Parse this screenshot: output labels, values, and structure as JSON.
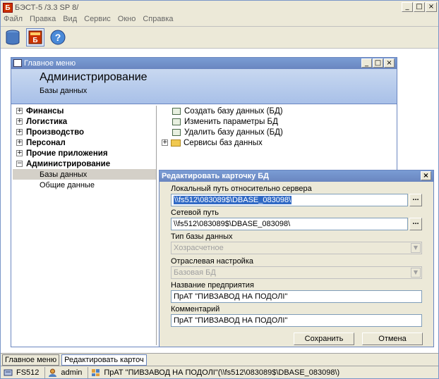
{
  "app": {
    "title": "БЭСТ-5 /3.3 SP 8/",
    "logo_text": "Б",
    "window_controls": {
      "minimize": "_",
      "maximize": "□",
      "close": "×"
    }
  },
  "menubar": [
    "Файл",
    "Правка",
    "Вид",
    "Сервис",
    "Окно",
    "Справка"
  ],
  "toolbar": {
    "icons": [
      "database-icon",
      "app-logo-icon",
      "help-icon"
    ],
    "app_logo_text": "Б",
    "help_text": "?"
  },
  "main_menu": {
    "title": "Главное меню",
    "header_title": "Администрирование",
    "header_subtitle": "Базы данных",
    "tree": [
      {
        "label": "Финансы",
        "expanded": false
      },
      {
        "label": "Логистика",
        "expanded": false
      },
      {
        "label": "Производство",
        "expanded": false
      },
      {
        "label": "Персонал",
        "expanded": false
      },
      {
        "label": "Прочие приложения",
        "expanded": false
      },
      {
        "label": "Администрирование",
        "expanded": true
      }
    ],
    "tree_children": [
      {
        "label": "Базы данных",
        "selected": true
      },
      {
        "label": "Общие данные",
        "selected": false
      }
    ],
    "actions": [
      "Создать базу данных (БД)",
      "Изменить параметры БД",
      "Удалить базу данных (БД)"
    ],
    "services_folder": "Сервисы баз данных"
  },
  "dialog": {
    "title": "Редактировать карточку БД",
    "local_path_label": "Локальный путь относительно сервера",
    "local_path_value": "\\\\fs512\\083089$\\DBASE_083098\\",
    "network_path_label": "Сетевой путь",
    "network_path_value": "\\\\fs512\\083089$\\DBASE_083098\\",
    "db_type_label": "Тип базы данных",
    "db_type_value": "Хозрасчетное",
    "industry_label": "Отраслевая настройка",
    "industry_value": "Базовая БД",
    "company_label": "Название предприятия",
    "company_value": "ПрАТ \"ПИВЗАВОД НА ПОДОЛІ\"",
    "comment_label": "Комментарий",
    "comment_value": "ПрАТ \"ПИВЗАВОД НА ПОДОЛІ\"",
    "browse_label": "...",
    "save_label": "Сохранить",
    "cancel_label": "Отмена"
  },
  "taskbar": {
    "tabs": [
      "Главное меню",
      "Редактировать карточ"
    ]
  },
  "statusbar": {
    "server": "FS512",
    "user": "admin",
    "database": "ПрАТ \"ПИВЗАВОД НА ПОДОЛІ\"(\\\\fs512\\083089$\\DBASE_083098\\)"
  }
}
